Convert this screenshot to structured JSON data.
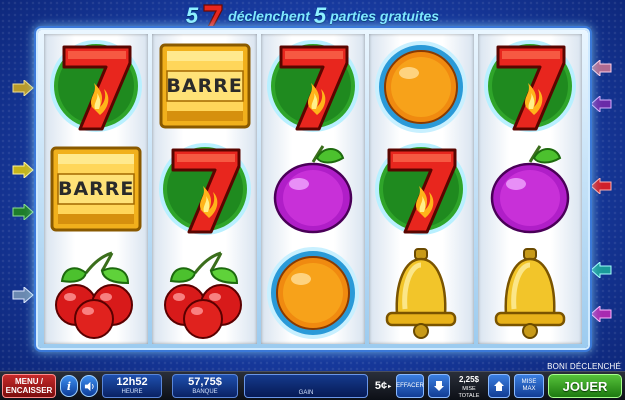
{
  "title": {
    "count_left": "5",
    "mid_text": "déclenchent",
    "count_right": "5",
    "end_text": "parties gratuites",
    "symbol": "seven-icon"
  },
  "reels": [
    [
      "seven",
      "bar",
      "cherry"
    ],
    [
      "bar",
      "seven",
      "cherry"
    ],
    [
      "seven",
      "plum",
      "orange"
    ],
    [
      "orange",
      "seven",
      "bell"
    ],
    [
      "seven",
      "plum",
      "bell"
    ]
  ],
  "symbol_labels": {
    "bar": "BARRE"
  },
  "colors": {
    "background": "#1a3fa8",
    "seven_red": "#e8261e",
    "green_disc": "#2fa52a",
    "accent_cyan": "#7fe8ff",
    "play_green": "#3aa824",
    "menu_red": "#b02020"
  },
  "status": {
    "bonus_triggered": "BONI DÉCLENCHÉ"
  },
  "bottom_bar": {
    "menu_line1": "MENU /",
    "menu_line2": "ENCAISSER",
    "info_icon": "i",
    "sound_icon": "speaker-icon",
    "time_value": "12h52",
    "time_label": "HEURE",
    "bank_value": "57,75$",
    "bank_label": "BANQUE",
    "gain_label": "GAIN",
    "denomination": "5¢",
    "clear_label": "EFFACER",
    "total_bet_value": "2,25$",
    "total_bet_label": "MISE TOTALE",
    "max_bet_line1": "MISE",
    "max_bet_line2": "MAX",
    "play_label": "JOUER"
  }
}
